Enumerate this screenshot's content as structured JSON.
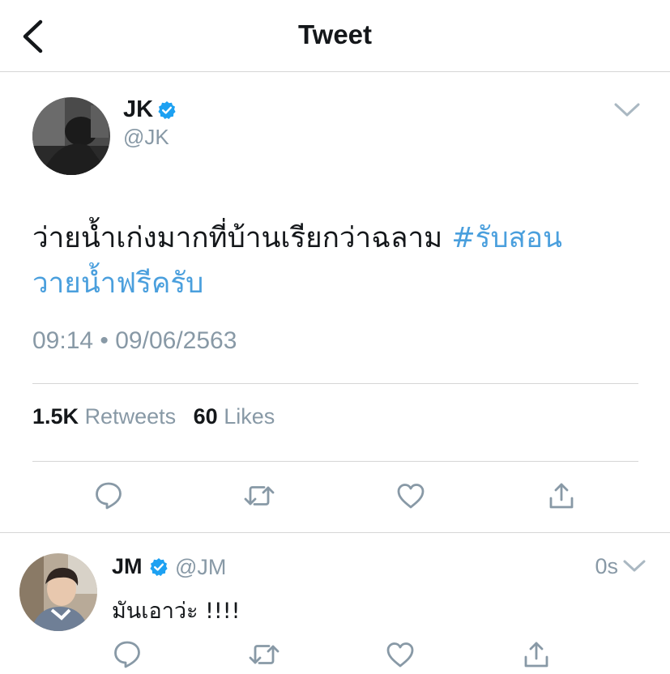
{
  "header": {
    "title": "Tweet"
  },
  "tweet": {
    "author_name": "JK",
    "author_handle": "@JK",
    "text_plain": "ว่ายน้ำเก่งมากที่บ้านเรียกว่าฉลาม ",
    "hashtag": "#รับสอนวายน้ำฟรีครับ",
    "timestamp": "09:14 • 09/06/2563",
    "retweets_count": "1.5K",
    "retweets_label": "Retweets",
    "likes_count": "60",
    "likes_label": "Likes"
  },
  "reply": {
    "author_name": "JM",
    "author_handle": "@JM",
    "time": "0s",
    "text": "มันเอาว่ะ !!!!"
  },
  "colors": {
    "accent": "#4a9fdd",
    "secondary_text": "#8899a6",
    "verified": "#1da1f2",
    "divider": "#d6d6d6"
  }
}
